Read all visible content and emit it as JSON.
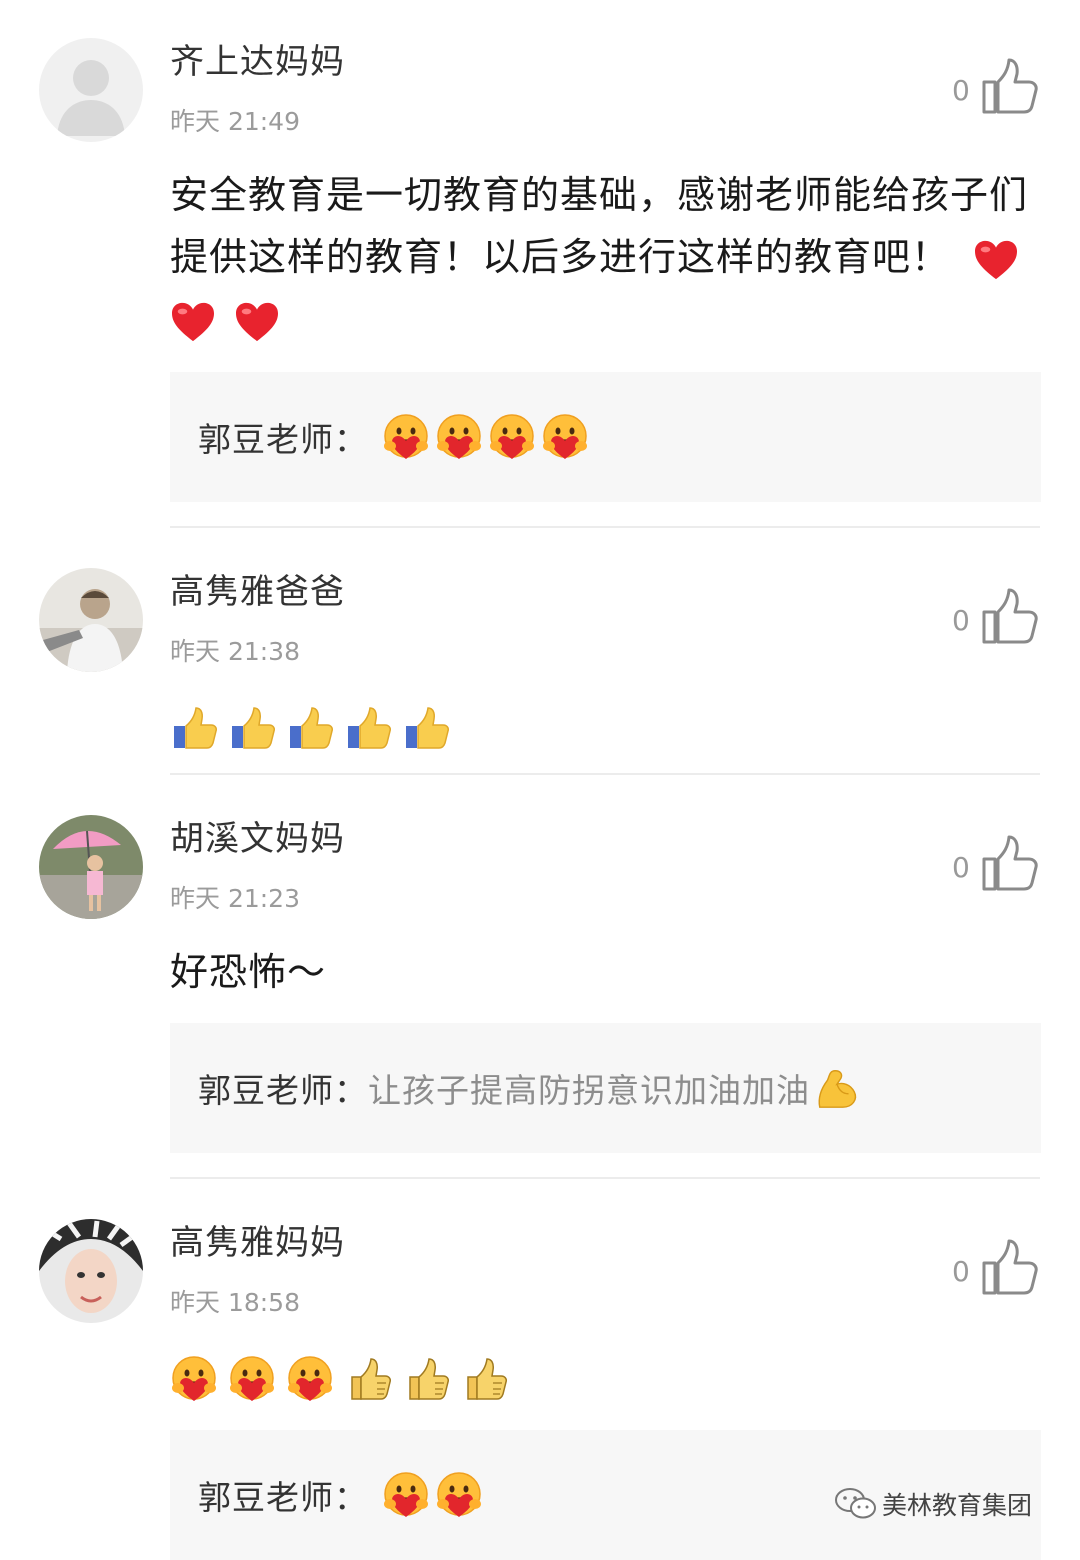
{
  "comments": [
    {
      "nickname": "齐上达妈妈",
      "time": "昨天 21:49",
      "likes": "0",
      "avatar": "default-avatar",
      "text": "安全教育是一切教育的基础，感谢老师能给孩子们提供这样的教育！以后多进行这样的教育吧！",
      "text_emojis": [
        "heart",
        "heart",
        "heart"
      ],
      "reply": {
        "name": "郭豆老师：",
        "text": "",
        "emojis": [
          "hug",
          "hug",
          "hug",
          "hug"
        ]
      }
    },
    {
      "nickname": "高隽雅爸爸",
      "time": "昨天 21:38",
      "likes": "0",
      "avatar": "photo-avatar-man",
      "emojis": [
        "thumbs-up",
        "thumbs-up",
        "thumbs-up",
        "thumbs-up",
        "thumbs-up"
      ]
    },
    {
      "nickname": "胡溪文妈妈",
      "time": "昨天 21:23",
      "likes": "0",
      "avatar": "photo-avatar-child-umbrella",
      "text": "好恐怖～",
      "reply": {
        "name": "郭豆老师：",
        "text": "让孩子提高防拐意识加油加油",
        "emojis": [
          "flexed-biceps"
        ]
      }
    },
    {
      "nickname": "高隽雅妈妈",
      "time": "昨天 18:58",
      "likes": "0",
      "avatar": "photo-avatar-woman",
      "emojis": [
        "hug",
        "hug",
        "hug",
        "thumbs-up-yellow",
        "thumbs-up-yellow",
        "thumbs-up-yellow"
      ],
      "reply": {
        "name": "郭豆老师：",
        "text": "",
        "emojis": [
          "hug",
          "hug"
        ]
      }
    }
  ],
  "watermark": {
    "text": "美林教育集团",
    "icon": "wechat-icon"
  },
  "colors": {
    "background": "#ffffff",
    "reply_bg": "#f7f7f7",
    "muted": "#9b9b9b",
    "heart": "#e8232e"
  }
}
